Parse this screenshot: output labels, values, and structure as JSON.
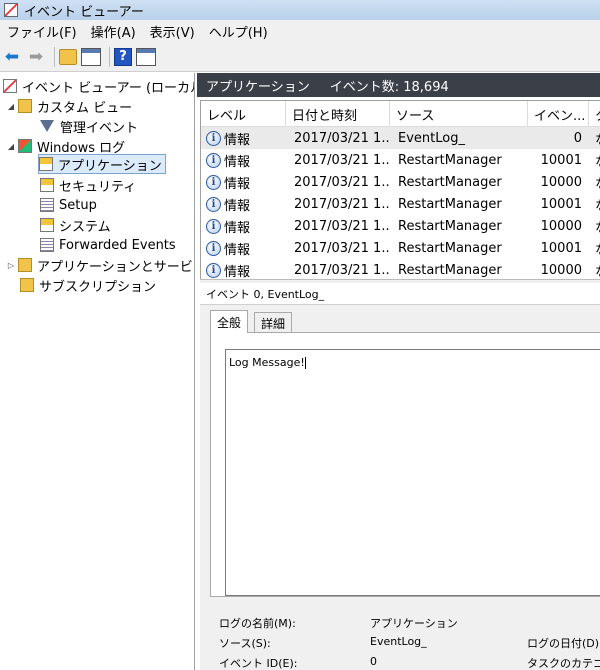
{
  "window": {
    "title": "イベント ビューアー"
  },
  "menu": [
    "ファイル(F)",
    "操作(A)",
    "表示(V)",
    "ヘルプ(H)"
  ],
  "toolbar": {
    "help": "?"
  },
  "tree": {
    "root": "イベント ビューアー (ローカル",
    "custom_view": "カスタム ビュー",
    "admin_events": "管理イベント",
    "windows_logs": "Windows ログ",
    "application": "アプリケーション",
    "security": "セキュリティ",
    "setup": "Setup",
    "system": "システム",
    "forwarded": "Forwarded Events",
    "apps_services": "アプリケーションとサービス",
    "subscriptions": "サブスクリプション"
  },
  "header": {
    "log_name": "アプリケーション",
    "event_count": "イベント数: 18,694"
  },
  "table": {
    "columns": [
      "レベル",
      "日付と時刻",
      "ソース",
      "イベン...",
      "タ"
    ],
    "rows": [
      {
        "level": "情報",
        "datetime": "2017/03/21 1...",
        "source": "EventLog_",
        "event_id": "0",
        "task": "な"
      },
      {
        "level": "情報",
        "datetime": "2017/03/21 1...",
        "source": "RestartManager",
        "event_id": "10001",
        "task": "な"
      },
      {
        "level": "情報",
        "datetime": "2017/03/21 1...",
        "source": "RestartManager",
        "event_id": "10000",
        "task": "な"
      },
      {
        "level": "情報",
        "datetime": "2017/03/21 1...",
        "source": "RestartManager",
        "event_id": "10001",
        "task": "な"
      },
      {
        "level": "情報",
        "datetime": "2017/03/21 1...",
        "source": "RestartManager",
        "event_id": "10000",
        "task": "な"
      },
      {
        "level": "情報",
        "datetime": "2017/03/21 1...",
        "source": "RestartManager",
        "event_id": "10001",
        "task": "な"
      },
      {
        "level": "情報",
        "datetime": "2017/03/21 1...",
        "source": "RestartManager",
        "event_id": "10000",
        "task": "な"
      }
    ]
  },
  "detail": {
    "title": "イベント 0, EventLog_",
    "tabs": {
      "general": "全般",
      "details": "詳細"
    },
    "message": "Log Message!",
    "fields": {
      "log_name_label": "ログの名前(M):",
      "log_name_value": "アプリケーション",
      "source_label": "ソース(S):",
      "source_value": "EventLog_",
      "logged_label": "ログの日付(D):",
      "event_id_label": "イベント ID(E):",
      "event_id_value": "0",
      "task_label": "タスクのカテゴリ("
    }
  }
}
